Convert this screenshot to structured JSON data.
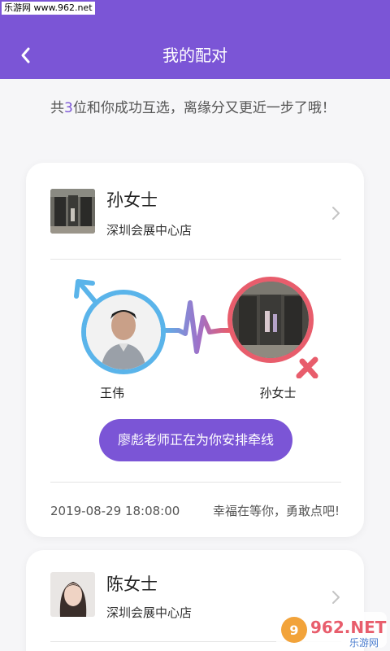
{
  "statusbar": {
    "site": "乐游网 www.962.net"
  },
  "header": {
    "title": "我的配对",
    "back_icon": "chevron-left-icon"
  },
  "intro": {
    "prefix": "共",
    "count": "3",
    "suffix": "位和你成功互选，离缘分又更近一步了哦！"
  },
  "matches": [
    {
      "name": "孙女士",
      "store": "深圳会展中心店",
      "left_person": "王伟",
      "right_person": "孙女士",
      "action": "廖彪老师正在为你安排牵线",
      "date": "2019-08-29 18:08:00",
      "message": "幸福在等你，勇敢点吧!"
    },
    {
      "name": "陈女士",
      "store": "深圳会展中心店"
    }
  ],
  "watermark": {
    "text": "962.NET",
    "sub": "乐游网"
  },
  "colors": {
    "brand": "#7b55d6",
    "male": "#5ab4ea",
    "female": "#e85d6c"
  }
}
